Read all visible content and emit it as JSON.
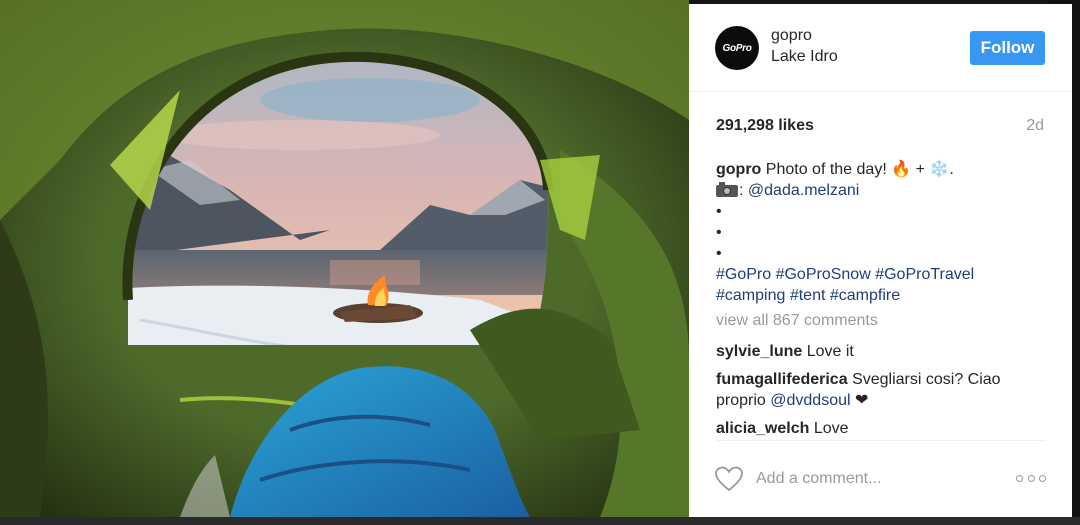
{
  "post": {
    "username": "gopro",
    "location": "Lake Idro",
    "avatar_text": "GoPro",
    "follow_label": "Follow",
    "likes": "291,298 likes",
    "age": "2d",
    "caption": {
      "author": "gopro",
      "text": "Photo of the day!",
      "emoji_fire": "🔥",
      "plus": "+",
      "emoji_snow": "❄️",
      "period": ".",
      "credit_prefix": ":",
      "credit_handle": "@dada.melzani",
      "dots": [
        "•",
        "•",
        "•"
      ],
      "hashtags_line1": "#GoPro #GoProSnow #GoProTravel",
      "hashtags_line2": "#camping #tent #campfire"
    },
    "view_all_comments": "view all 867 comments",
    "comments": [
      {
        "user": "sylvie_lune",
        "text": "Love it"
      },
      {
        "user": "fumagallifederica",
        "text": "Svegliarsi cosi? Ciao proprio",
        "mention": "@dvddsoul",
        "emoji": "❤"
      },
      {
        "user": "alicia_welch",
        "text": "Love"
      }
    ],
    "add_comment_placeholder": "Add a comment...",
    "icons": {
      "like": "heart-icon",
      "more": "more-options-icon",
      "camera": "camera-icon",
      "fire": "fire-emoji",
      "snowflake": "snowflake-emoji"
    },
    "colors": {
      "follow_button": "#3897f0",
      "link": "#1e3f78",
      "muted_text": "#999999",
      "text": "#262626"
    }
  }
}
